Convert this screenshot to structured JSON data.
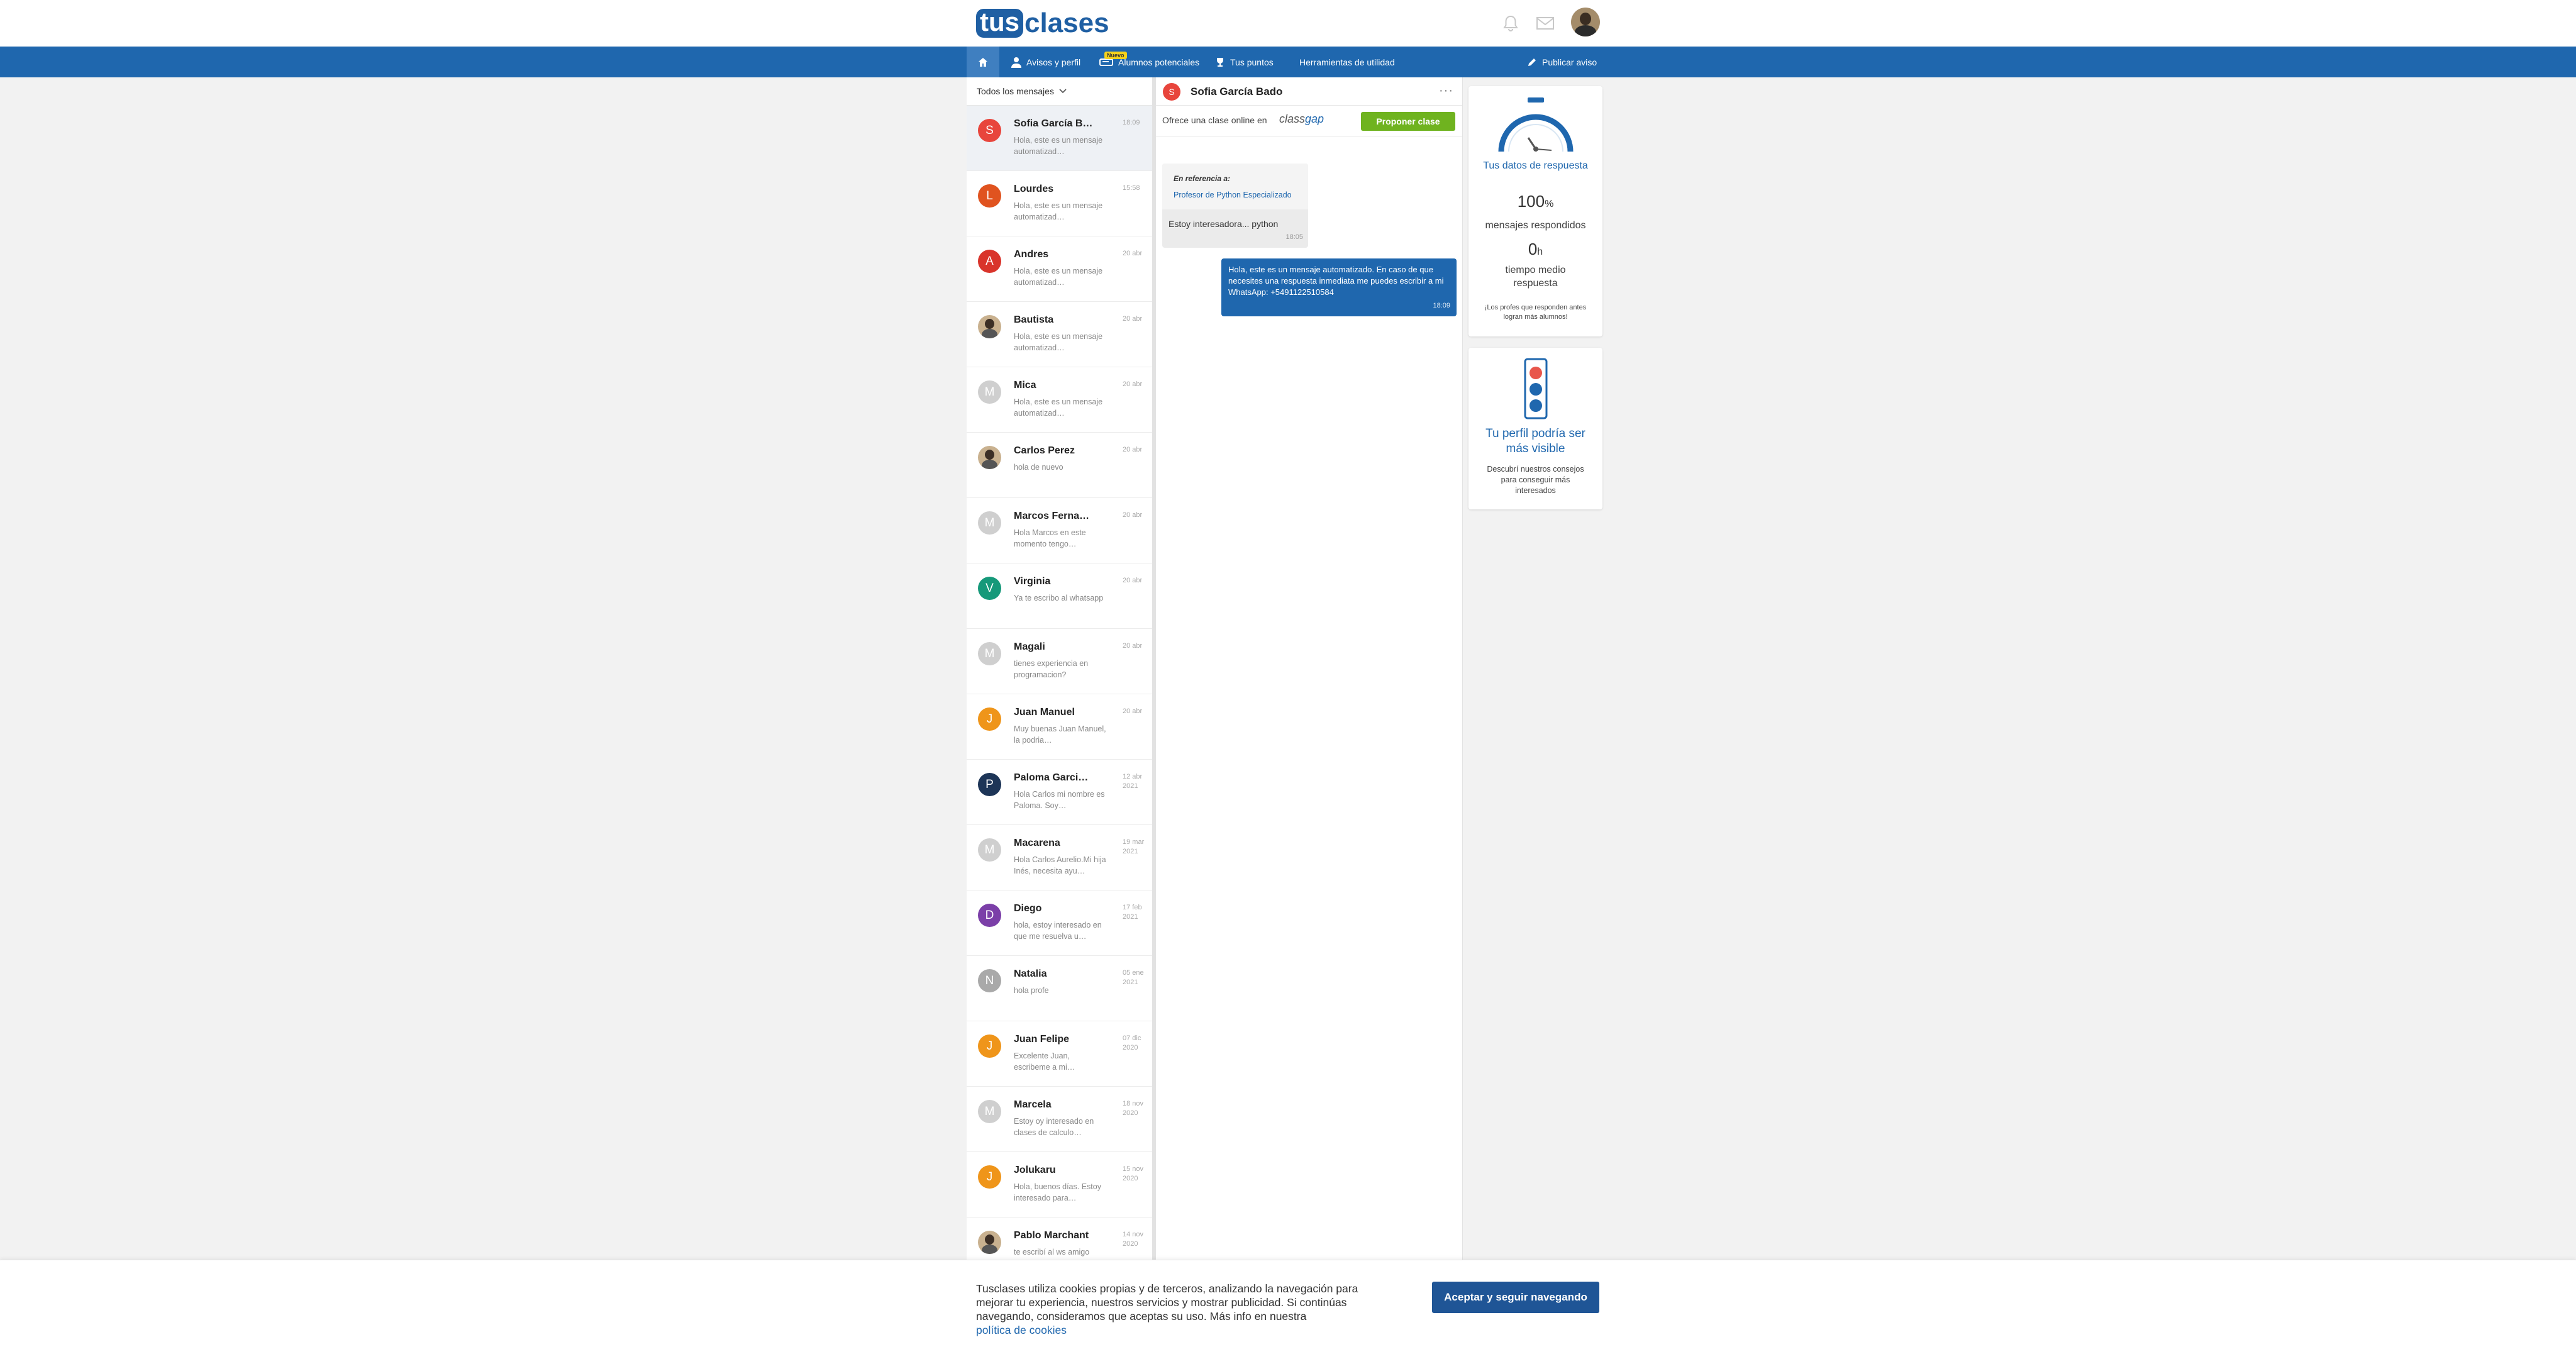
{
  "header": {
    "logo_left": "tus",
    "logo_right": "clases"
  },
  "nav": {
    "items": [
      {
        "label": "Avisos y perfil",
        "icon": "user-icon"
      },
      {
        "label": "Alumnos potenciales",
        "icon": "students-icon",
        "badge": "Nuevo"
      },
      {
        "label": "Tus puntos",
        "icon": "trophy-icon"
      },
      {
        "label": "Herramientas de utilidad",
        "icon": ""
      },
      {
        "label": "Publicar aviso",
        "icon": "pencil-icon"
      }
    ]
  },
  "inbox": {
    "filter_label": "Todos los mensajes",
    "conversations": [
      {
        "initial": "S",
        "name": "Sofia García B…",
        "date": "18:09",
        "preview": "Hola, este es un mensaje automatizad…",
        "color": "#e8453c"
      },
      {
        "initial": "L",
        "name": "Lourdes",
        "date": "15:58",
        "preview": "Hola, este es un mensaje automatizad…",
        "color": "#e0531f"
      },
      {
        "initial": "A",
        "name": "Andres",
        "date": "20 abr",
        "preview": "Hola, este es un mensaje automatizad…",
        "color": "#d9342b"
      },
      {
        "initial": "",
        "name": "Bautista",
        "date": "20 abr",
        "preview": "Hola, este es un mensaje automatizad…",
        "color": "#555555"
      },
      {
        "initial": "M",
        "name": "Mica",
        "date": "20 abr",
        "preview": "Hola, este es un mensaje automatizad…",
        "color": "#cfcfcf"
      },
      {
        "initial": "",
        "name": "Carlos Perez",
        "date": "20 abr",
        "preview": "hola de nuevo",
        "color": "#555555"
      },
      {
        "initial": "M",
        "name": "Marcos Ferna…",
        "date": "20 abr",
        "preview": "Hola Marcos en este momento tengo…",
        "color": "#cfcfcf"
      },
      {
        "initial": "V",
        "name": "Virginia",
        "date": "20 abr",
        "preview": "Ya te escribo al whatsapp",
        "color": "#16997a"
      },
      {
        "initial": "M",
        "name": "Magali",
        "date": "20 abr",
        "preview": "tienes experiencia en programacion?",
        "color": "#cfcfcf"
      },
      {
        "initial": "J",
        "name": "Juan Manuel",
        "date": "20 abr",
        "preview": "Muy buenas Juan Manuel, la podria…",
        "color": "#ef951a"
      },
      {
        "initial": "P",
        "name": "Paloma Garci…",
        "date": "12 abr 2021",
        "preview": "Hola Carlos mi nombre es Paloma. Soy…",
        "color": "#1d3557"
      },
      {
        "initial": "M",
        "name": "Macarena",
        "date": "19 mar 2021",
        "preview": "Hola Carlos Aurelio.Mi hija Inés, necesita ayu…",
        "color": "#cfcfcf"
      },
      {
        "initial": "D",
        "name": "Diego",
        "date": "17 feb 2021",
        "preview": "hola, estoy interesado en que me resuelva u…",
        "color": "#7b3fa8"
      },
      {
        "initial": "N",
        "name": "Natalia",
        "date": "05 ene 2021",
        "preview": "hola profe",
        "color": "#a9a9a9"
      },
      {
        "initial": "J",
        "name": "Juan Felipe",
        "date": "07 dic 2020",
        "preview": "Excelente Juan, escribeme a mi…",
        "color": "#ef951a"
      },
      {
        "initial": "M",
        "name": "Marcela",
        "date": "18 nov 2020",
        "preview": "Estoy oy interesado en clases de calculo…",
        "color": "#cfcfcf"
      },
      {
        "initial": "J",
        "name": "Jolukaru",
        "date": "15 nov 2020",
        "preview": "Hola, buenos días. Estoy interesado para…",
        "color": "#ef951a"
      },
      {
        "initial": "",
        "name": "Pablo Marchant",
        "date": "14 nov 2020",
        "preview": "te escribí al ws amigo",
        "color": "#555555"
      }
    ]
  },
  "chat": {
    "contact_initial": "S",
    "contact_name": "Sofia García Bado",
    "more_label": "···",
    "offer_text": "Ofrece una clase online en",
    "offer_logo_a": "class",
    "offer_logo_b": "gap",
    "propose_button": "Proponer clase",
    "incoming": {
      "ref_label": "En referencia a:",
      "ref_link": "Profesor de Python Especializado",
      "text": "Estoy interesadora... python",
      "time": "18:05"
    },
    "outgoing": {
      "text": "Hola, este es un mensaje automatizado. En caso de que necesites una respuesta inmediata me puedes escribir a mi WhatsApp: +5491122510584",
      "time": "18:09"
    }
  },
  "stats_card": {
    "title": "Tus datos de respuesta",
    "percent_value": "100",
    "percent_unit": "%",
    "percent_label": "mensajes respondidos",
    "time_value": "0",
    "time_unit": "h",
    "time_label": "tiempo medio respuesta",
    "footnote": "¡Los profes que responden antes logran más alumnos!"
  },
  "visibility_card": {
    "title": "Tu perfil podría ser más visible",
    "text": "Descubrí nuestros consejos para conseguir más interesados"
  },
  "cookie": {
    "text": "Tusclases utiliza cookies propias y de terceros, analizando la navegación para mejorar tu experiencia, nuestros servicios y mostrar publicidad. Si continúas navegando, consideramos que aceptas su uso. Más info en nuestra",
    "link": "política de cookies",
    "accept_button": "Aceptar y seguir navegando"
  }
}
